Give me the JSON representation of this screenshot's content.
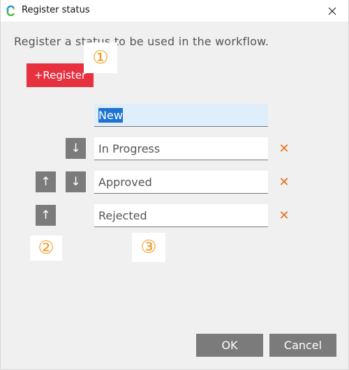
{
  "window": {
    "title": "Register status",
    "close_symbol": "✕"
  },
  "instruction": "Register a status to be used in the workflow.",
  "register_button": {
    "label": "+Register"
  },
  "callouts": {
    "one": "①",
    "two": "②",
    "three": "③"
  },
  "statuses": [
    {
      "value": "New",
      "selected": true
    },
    {
      "value": "In Progress"
    },
    {
      "value": "Approved"
    },
    {
      "value": "Rejected"
    }
  ],
  "arrows": {
    "up": "↑",
    "down": "↓"
  },
  "delete_symbol": "✕",
  "footer": {
    "ok_label": "OK",
    "cancel_label": "Cancel"
  },
  "colors": {
    "accent": "#e8313f",
    "callout": "#f29a1f",
    "delete": "#e8711f",
    "selection": "#1e73d2",
    "button_gray": "#7b7b7b"
  },
  "icons": {
    "app": "app-logo-icon",
    "close": "close-icon",
    "up": "arrow-up-icon",
    "down": "arrow-down-icon",
    "delete": "delete-x-icon"
  }
}
